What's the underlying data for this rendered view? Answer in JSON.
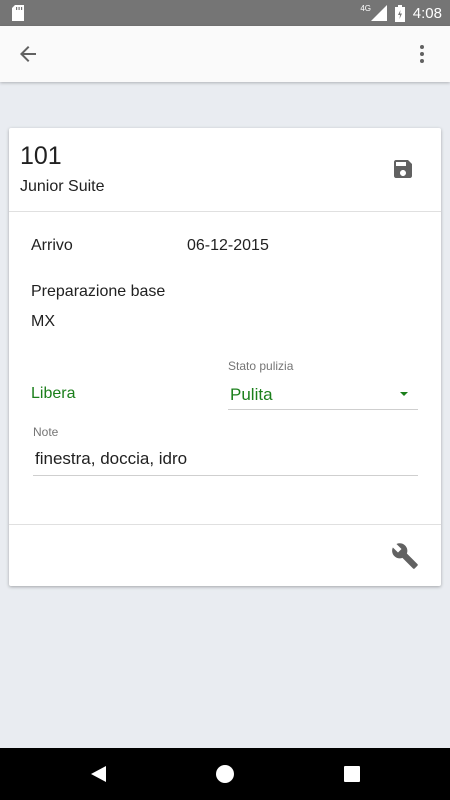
{
  "status_bar": {
    "time": "4:08",
    "network": "4G"
  },
  "room": {
    "number": "101",
    "type": "Junior Suite",
    "arrival_label": "Arrivo",
    "arrival_date": "06-12-2015",
    "prep_label": "Preparazione base",
    "prep_value": "MX",
    "availability": "Libera",
    "cleaning_label": "Stato pulizia",
    "cleaning_value": "Pulita",
    "notes_label": "Note",
    "notes_value": "finestra, doccia, idro"
  },
  "colors": {
    "accent": "#1b7f1b",
    "status_bar": "#757575"
  },
  "icons": {
    "back": "arrow-back-icon",
    "more": "more-vert-icon",
    "save": "save-icon",
    "tools": "wrench-icon"
  }
}
